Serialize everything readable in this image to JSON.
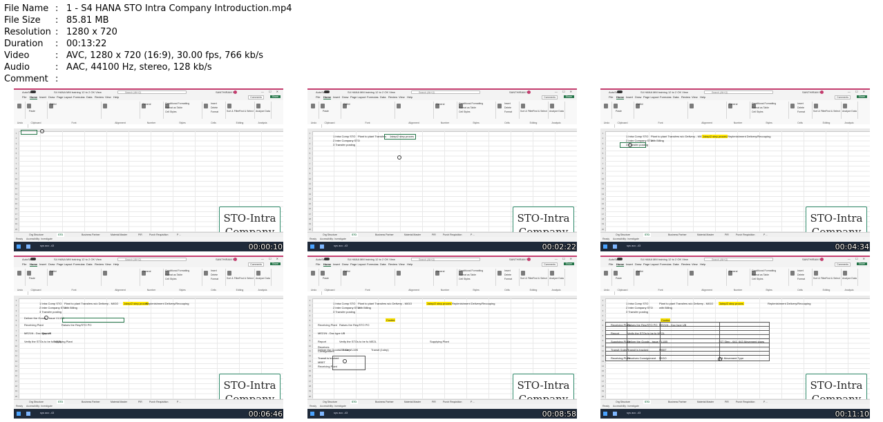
{
  "metadata": [
    {
      "key": "File Name",
      "value": "1 - S4 HANA STO Intra Company Introduction.mp4"
    },
    {
      "key": "File Size",
      "value": "85.81 MB"
    },
    {
      "key": "Resolution",
      "value": "1280 x 720"
    },
    {
      "key": "Duration",
      "value": "00:13:22"
    },
    {
      "key": "Video",
      "value": "AVC, 1280 x 720 (16:9), 30.00 fps, 766 kb/s"
    },
    {
      "key": "Audio",
      "value": "AAC, 44100 Hz, stereo, 128 kb/s"
    },
    {
      "key": "Comment",
      "value": ""
    }
  ],
  "excel": {
    "autosave": "AutoSave",
    "file_title": "S4 HANA MM training 12 to 2 OK View",
    "search_placeholder": "Search (Alt+Q)",
    "user": "SANTHIRAM S",
    "window_buttons": "—  ☐  ✕",
    "menu": [
      "File",
      "Home",
      "Insert",
      "Draw",
      "Page Layout",
      "Formulas",
      "Data",
      "Review",
      "View",
      "Help"
    ],
    "comments_label": "Comments",
    "share_label": "Share",
    "ribbon": {
      "undo": "Undo",
      "clipboard": "Clipboard",
      "paste": "Paste",
      "font_name": "Calibri",
      "font": "Font",
      "alignment": "Alignment",
      "number": "Number",
      "number_format": "General",
      "conditional": "Conditional Formatting",
      "format_table": "Format as Table",
      "cell_styles": "Cell Styles",
      "styles": "Styles",
      "insert": "Insert",
      "delete": "Delete",
      "format": "Format",
      "cells": "Cells",
      "sort": "Sort & Filter",
      "find": "Find & Select",
      "editing": "Editing",
      "analyze": "Analyze Data",
      "analysis": "Analysis"
    },
    "tabs": [
      "Org Structure",
      "STO",
      "Business Partner",
      "Material Master",
      "PIR",
      "Purch Requisition",
      "P ..."
    ],
    "active_tab": "STO",
    "status_ready": "Ready",
    "status_access": "Accessibility: Investigate",
    "taskbar_text": "sys acc -43"
  },
  "logo": {
    "line1": "STO-Intra",
    "line2": "Company"
  },
  "frames": [
    {
      "time": "00:00:10",
      "cells": []
    },
    {
      "time": "00:02:22",
      "cells": [
        {
          "t": "1 Intra Comp STO",
          "hl": false
        },
        {
          "t": "2 Inter Company STO",
          "hl": false
        },
        {
          "t": "3 Transfer posting",
          "hl": false
        },
        {
          "t": "Plant to plant Transfers",
          "hl": false
        },
        {
          "t": "1step/2 step proces",
          "hl": false
        }
      ]
    },
    {
      "time": "00:04:34",
      "cells": [
        {
          "t": "1 Intra Comp STO",
          "hl": false
        },
        {
          "t": "2 Inter Company STO",
          "hl": false
        },
        {
          "t": "3 Transfer posting",
          "hl": false
        },
        {
          "t": "Plant to plant Transfers w/o Delivery - MIGO",
          "hl": false
        },
        {
          "t": "with Billing",
          "hl": false
        },
        {
          "t": "1step/2 step proces",
          "hl": true
        },
        {
          "t": "Replenishment Delivery/Recouping",
          "hl": false
        }
      ]
    },
    {
      "time": "00:06:46",
      "cells": [
        {
          "t": "1 Intra Comp STO",
          "hl": false
        },
        {
          "t": "2 Inter Company STO",
          "hl": false
        },
        {
          "t": "3 Transfer posting",
          "hl": false
        },
        {
          "t": "Plant to plant Transfers w/o Delivery - MIGO",
          "hl": false
        },
        {
          "t": "with Billing",
          "hl": false
        },
        {
          "t": "1step/2 step proces",
          "hl": true
        },
        {
          "t": "Replenishment Delivery/Recouping",
          "hl": false
        },
        {
          "t": "Receiving Plant",
          "hl": false
        },
        {
          "t": "Raises the Req/STO PO",
          "hl": false
        },
        {
          "t": "ME21N - Doc type UB",
          "hl": false
        },
        {
          "t": "Report",
          "hl": false
        },
        {
          "t": "Verify the STOs to be fu ME2L",
          "hl": false
        },
        {
          "t": "Supplying Plant",
          "hl": false
        },
        {
          "t": "Deliver the Goods - issue VL10B",
          "hl": false
        }
      ]
    },
    {
      "time": "00:08:58",
      "cells": [
        {
          "t": "1 Intra Comp STO",
          "hl": false
        },
        {
          "t": "2 Inter Company STO",
          "hl": false
        },
        {
          "t": "3 Transfer posting",
          "hl": false
        },
        {
          "t": "Plant to plant Transfers w/o Delivery - MIGO",
          "hl": false
        },
        {
          "t": "with Billing",
          "hl": false
        },
        {
          "t": "1step/2 step proces",
          "hl": true
        },
        {
          "t": "Replenishment Delivery/Recouping",
          "hl": false
        },
        {
          "t": "Cookie",
          "hl": true
        },
        {
          "t": "Receiving Plant",
          "hl": false
        },
        {
          "t": "Raises the Req/STO PO",
          "hl": false
        },
        {
          "t": "ME21N - Doc type UB",
          "hl": false
        },
        {
          "t": "Report",
          "hl": false
        },
        {
          "t": "Verify the STOs to be fu ME2L",
          "hl": false
        },
        {
          "t": "Supplying Plant",
          "hl": false
        },
        {
          "t": "Deliver the Goods - issue VL10B",
          "hl": false
        },
        {
          "t": "1ST Step",
          "hl": false
        },
        {
          "t": "Transit (1step)",
          "hl": false
        },
        {
          "t": "Transit is tracked",
          "hl": false
        },
        {
          "t": "MB5T",
          "hl": false
        },
        {
          "t": "Receiving Plant",
          "hl": false
        },
        {
          "t": "Receives",
          "hl": false
        },
        {
          "t": "Consignment",
          "hl": false
        }
      ]
    },
    {
      "time": "00:11:10",
      "cells": [
        {
          "t": "1 Intra Comp STO",
          "hl": false
        },
        {
          "t": "2 Inter Company STO",
          "hl": false
        },
        {
          "t": "3 Transfer posting",
          "hl": false
        },
        {
          "t": "Plant to plant Transfers w/o Delivery - MIGO",
          "hl": false
        },
        {
          "t": "with Billing",
          "hl": false
        },
        {
          "t": "1step/2 step proces",
          "hl": true
        },
        {
          "t": "Replenishment Delivery/Recouping",
          "hl": false
        },
        {
          "t": "Cookie",
          "hl": true
        },
        {
          "t": "Receiving Plant",
          "hl": false
        },
        {
          "t": "Raises the Req/STO PO",
          "hl": false
        },
        {
          "t": "ME21N - Doc type UB",
          "hl": false
        },
        {
          "t": "Report",
          "hl": false
        },
        {
          "t": "Verify the STOs to be fu ME2L",
          "hl": false
        },
        {
          "t": "Supplying Plant",
          "hl": false
        },
        {
          "t": "Deliver the Goods - issue VL10B",
          "hl": false
        },
        {
          "t": "1ST Step - 641, 643 Movement types",
          "hl": false
        },
        {
          "t": "Transit (1step)",
          "hl": false
        },
        {
          "t": "Transit is tracked",
          "hl": false
        },
        {
          "t": "MB5T",
          "hl": false
        },
        {
          "t": "Receiving Plant",
          "hl": false
        },
        {
          "t": "Receives Consignment",
          "hl": false
        },
        {
          "t": "MIGO",
          "hl": false
        },
        {
          "t": "101 Movement Type",
          "hl": false
        }
      ]
    }
  ]
}
